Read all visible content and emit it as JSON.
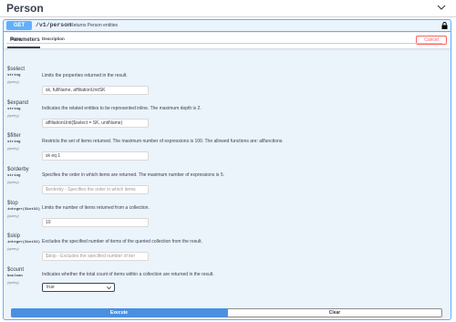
{
  "section": {
    "title": "Person"
  },
  "operation": {
    "method": "GET",
    "path": "/v1/person",
    "summary": "Returns Person entities"
  },
  "params_tab": {
    "label": "Parameters",
    "cancel_label": "Cancel"
  },
  "columns": {
    "name": "Name",
    "description": "Description"
  },
  "params": [
    {
      "name": "$select",
      "type": "string",
      "in": "(query)",
      "description": "Limits the properties returned in the result.",
      "value": "sk, fullName, affiliationUnitSK",
      "placeholder": ""
    },
    {
      "name": "$expand",
      "type": "string",
      "in": "(query)",
      "description": "Indicates the related entities to be represented inline. The maximum depth is 2.",
      "value": "affiliationUnit($select = SK, unitName)",
      "placeholder": ""
    },
    {
      "name": "$filter",
      "type": "string",
      "in": "(query)",
      "description": "Restricts the set of items returned. The maximum number of expressions is 100. The allowed functions are: allfunctions.",
      "value": "sk eq 1",
      "placeholder": ""
    },
    {
      "name": "$orderby",
      "type": "string",
      "in": "(query)",
      "description": "Specifies the order in which items are returned. The maximum number of expressions is 5.",
      "value": "",
      "placeholder": "$orderby - Specifies the order in which items"
    },
    {
      "name": "$top",
      "type": "integer($int32)",
      "in": "(query)",
      "description": "Limits the number of items returned from a collection.",
      "value": "10",
      "placeholder": ""
    },
    {
      "name": "$skip",
      "type": "integer($int32)",
      "in": "(query)",
      "description": "Excludes the specified number of items of the queried collection from the result.",
      "value": "",
      "placeholder": "$skip - Excludes the specified number of iter"
    },
    {
      "name": "$count",
      "type": "boolean",
      "in": "(query)",
      "description": "Indicates whether the total count of items within a collection are returned in the result.",
      "selected": "true"
    }
  ],
  "actions": {
    "execute_label": "Execute",
    "clear_label": "Clear"
  },
  "icons": {
    "collapse": "chevron-up-icon",
    "lock": "lock-icon",
    "select": "chevron-down-icon"
  },
  "colors": {
    "get_method": "#61affe",
    "execute": "#4990e2",
    "cancel": "#ff6060"
  }
}
